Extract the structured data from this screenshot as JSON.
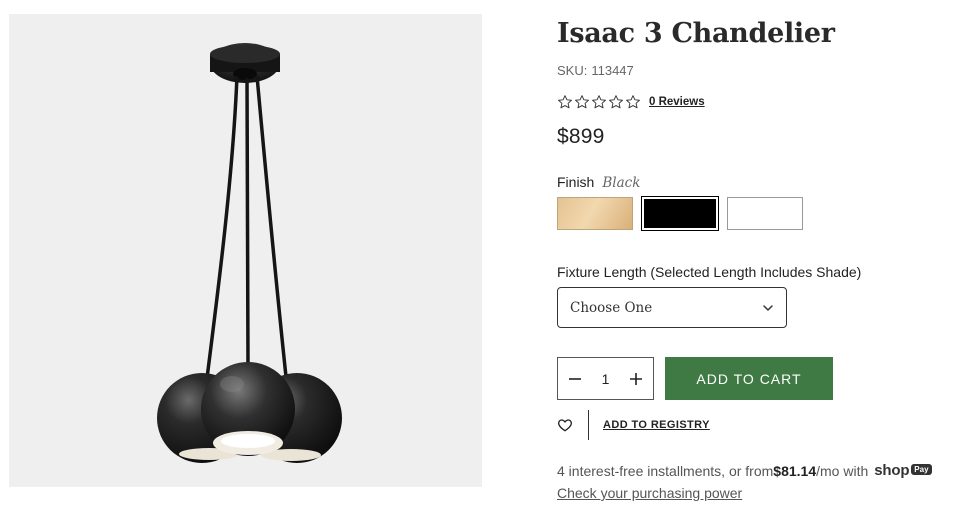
{
  "product": {
    "title": "Isaac 3 Chandelier",
    "sku_label": "SKU:",
    "sku": "113447",
    "rating": {
      "stars_filled": 0,
      "stars_total": 5
    },
    "reviews_link": "0 Reviews",
    "price": "$899"
  },
  "finish": {
    "label": "Finish",
    "selected": "Black",
    "swatches": [
      {
        "name": "Brass",
        "color": "#e6c898",
        "selected": false
      },
      {
        "name": "Black",
        "color": "#000000",
        "selected": true
      },
      {
        "name": "White",
        "color": "#ffffff",
        "selected": false
      }
    ]
  },
  "fixture_length": {
    "label": "Fixture Length (Selected Length Includes Shade)",
    "selected": "Choose One"
  },
  "cart": {
    "quantity": "1",
    "add_button": "ADD TO CART",
    "button_color": "#3f7a45"
  },
  "registry": {
    "link": "ADD TO REGISTRY"
  },
  "installments": {
    "prefix": "4 interest-free installments, or from ",
    "amount": "$81.14",
    "suffix": "/mo with",
    "shop_logo": "shop",
    "pay_badge": "Pay",
    "link": "Check your purchasing power"
  }
}
